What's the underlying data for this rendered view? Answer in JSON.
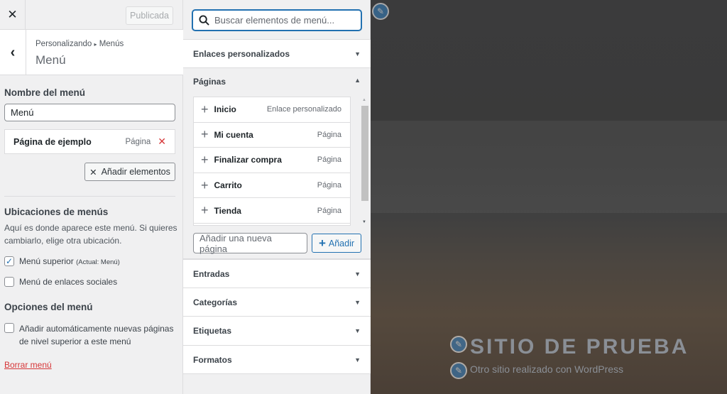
{
  "topbar": {
    "publish_label": "Publicada"
  },
  "header": {
    "breadcrumb_root": "Personalizando",
    "breadcrumb_sep": "▸",
    "breadcrumb_current": "Menús",
    "title": "Menú"
  },
  "menu_name": {
    "label": "Nombre del menú",
    "value": "Menú"
  },
  "menu_items": [
    {
      "title": "Página de ejemplo",
      "type": "Página"
    }
  ],
  "add_items_label": "Añadir elementos",
  "locations": {
    "title": "Ubicaciones de menús",
    "description": "Aquí es donde aparece este menú. Si quieres cambiarlo, elige otra ubicación.",
    "options": [
      {
        "label": "Menú superior",
        "note": "(Actual: Menú)",
        "checked": true
      },
      {
        "label": "Menú de enlaces sociales",
        "checked": false
      }
    ]
  },
  "options": {
    "title": "Opciones del menú",
    "auto_add_label": "Añadir automáticamente nuevas páginas de nivel superior a este menú"
  },
  "delete_label": "Borrar menú",
  "search": {
    "placeholder": "Buscar elementos de menú..."
  },
  "sections": [
    "Enlaces personalizados",
    "Páginas",
    "Entradas",
    "Categorías",
    "Etiquetas",
    "Formatos"
  ],
  "pages": [
    {
      "name": "Inicio",
      "type": "Enlace personalizado"
    },
    {
      "name": "Mi cuenta",
      "type": "Página"
    },
    {
      "name": "Finalizar compra",
      "type": "Página"
    },
    {
      "name": "Carrito",
      "type": "Página"
    },
    {
      "name": "Tienda",
      "type": "Página"
    }
  ],
  "new_page": {
    "placeholder": "Añadir una nueva página",
    "button": "Añadir"
  },
  "preview": {
    "site_title": "SITIO DE PRUEBA",
    "tagline": "Otro sitio realizado con WordPress"
  }
}
